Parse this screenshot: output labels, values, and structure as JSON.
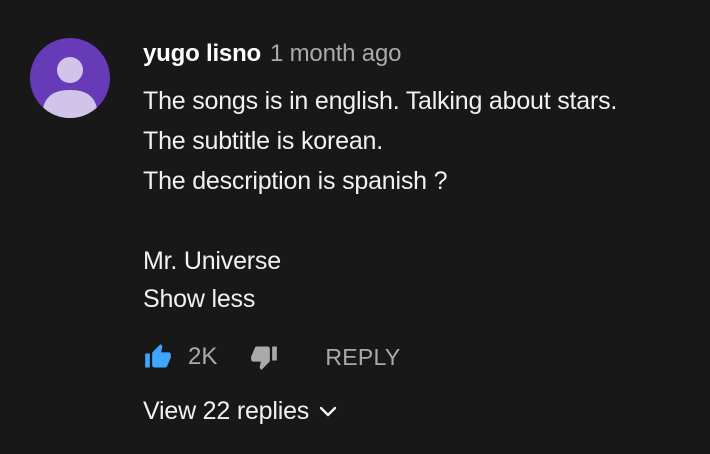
{
  "comment": {
    "author": "yugo lisno",
    "time": "1 month ago",
    "lines": [
      "The songs is in english. Talking about stars.",
      "The subtitle is korean.",
      "The description is spanish ?",
      "",
      "Mr. Universe"
    ],
    "show_less_label": "Show less",
    "like_count": "2K",
    "reply_label": "REPLY",
    "view_replies_label": "View 22 replies",
    "liked": true
  },
  "colors": {
    "background": "#181818",
    "avatar_bg": "#673ab7",
    "avatar_fg": "#d1c4e9",
    "like_active": "#3ea6ff",
    "muted_text": "#aaaaaa",
    "primary_text": "#f1f1f1"
  },
  "icons": {
    "avatar": "default-person-avatar",
    "like": "thumbs-up-icon",
    "dislike": "thumbs-down-icon",
    "chevron": "chevron-down-icon"
  }
}
